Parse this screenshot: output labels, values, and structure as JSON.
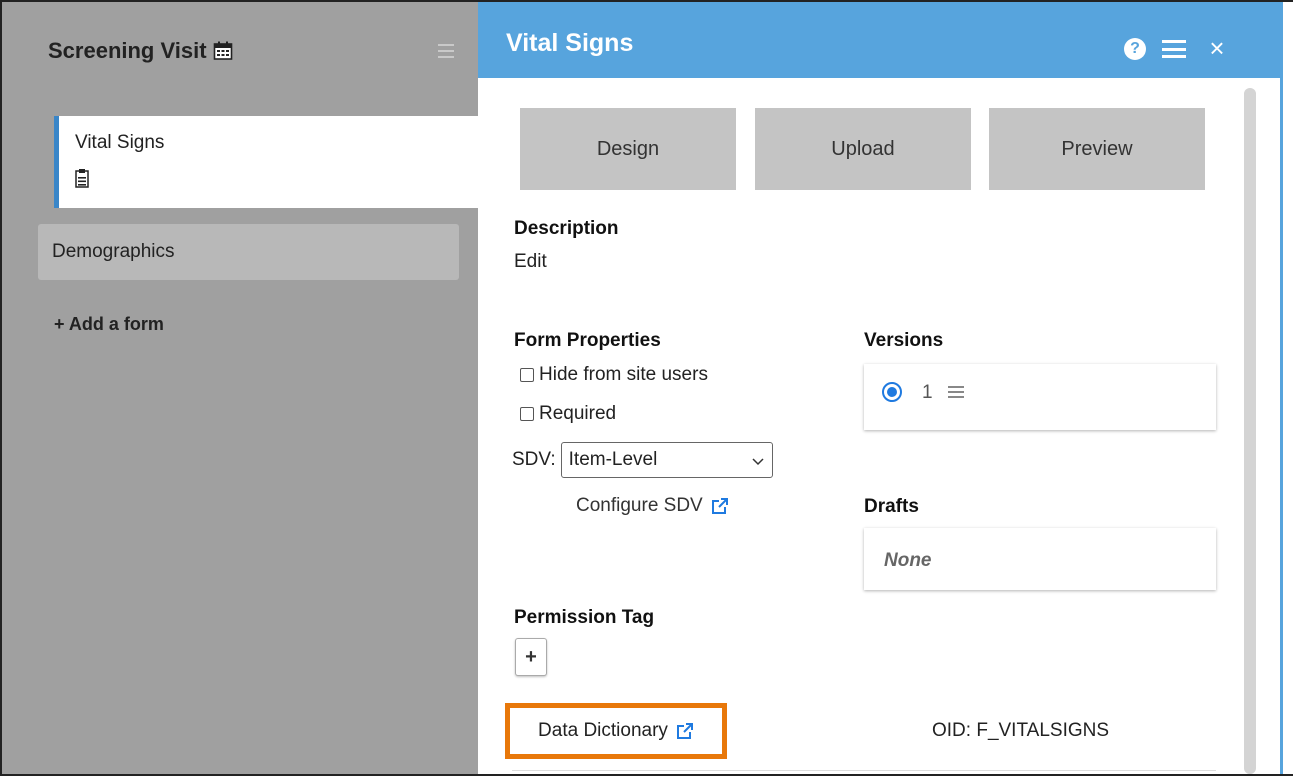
{
  "left_panel": {
    "visit_title": "Screening Visit",
    "forms": [
      {
        "label": "Vital Signs",
        "active": true
      },
      {
        "label": "Demographics",
        "active": false
      }
    ],
    "add_form_label": "+ Add a form"
  },
  "right_panel": {
    "title": "Vital Signs",
    "help_label": "?",
    "close_label": "×",
    "tabs": [
      {
        "label": "Design"
      },
      {
        "label": "Upload"
      },
      {
        "label": "Preview"
      }
    ],
    "description": {
      "title": "Description",
      "edit_label": "Edit"
    },
    "form_properties": {
      "title": "Form Properties",
      "hide_label": "Hide from site users",
      "required_label": "Required",
      "sdv_label": "SDV:",
      "sdv_value": "Item-Level",
      "configure_label": "Configure SDV"
    },
    "versions": {
      "title": "Versions",
      "items": [
        {
          "number": "1",
          "selected": true
        }
      ]
    },
    "drafts": {
      "title": "Drafts",
      "empty_label": "None"
    },
    "permission_tag": {
      "title": "Permission Tag",
      "add_label": "+"
    },
    "data_dictionary_label": "Data Dictionary",
    "oid_label": "OID: F_VITALSIGNS"
  },
  "colors": {
    "header_blue": "#57a4dd",
    "active_border": "#3a86c8",
    "highlight_orange": "#e8780a",
    "link_blue": "#1f7ae0"
  },
  "icons": [
    "calendar-icon",
    "menu-icon",
    "clipboard-icon",
    "help-icon",
    "close-icon",
    "external-link-icon",
    "chevron-down-icon"
  ]
}
